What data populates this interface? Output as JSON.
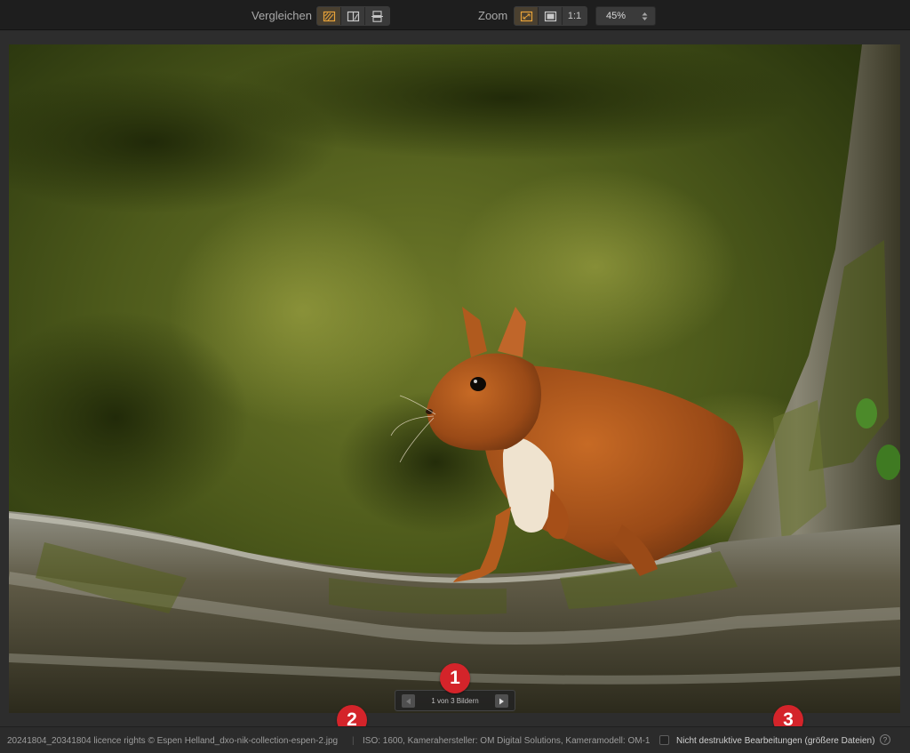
{
  "toolbar": {
    "compare_label": "Vergleichen",
    "zoom_label": "Zoom",
    "zoom_one_to_one": "1:1",
    "zoom_value": "45%"
  },
  "viewer": {
    "image_counter": "1 von 3 Bildern",
    "callouts": [
      "1",
      "2",
      "3"
    ]
  },
  "statusbar": {
    "file_info": "20241804_20341804 licence rights © Espen Helland_dxo-nik-collection-espen-2.jpg",
    "separator": "|",
    "exif_info": "ISO: 1600, Kamerahersteller: OM Digital Solutions, Kameramodell: OM-1",
    "nondestructive_label": "Nicht destruktive Bearbeitungen (größere Dateien)",
    "help_glyph": "?"
  },
  "colors": {
    "accent": "#e8a33a",
    "badge": "#d4242a"
  },
  "icons": {
    "compare_modes": [
      "split-single-icon",
      "side-by-side-icon",
      "stacked-icon"
    ],
    "zoom_modes": [
      "fit-icon",
      "fill-icon"
    ],
    "nav": [
      "chevron-left-icon",
      "chevron-right-icon"
    ]
  }
}
